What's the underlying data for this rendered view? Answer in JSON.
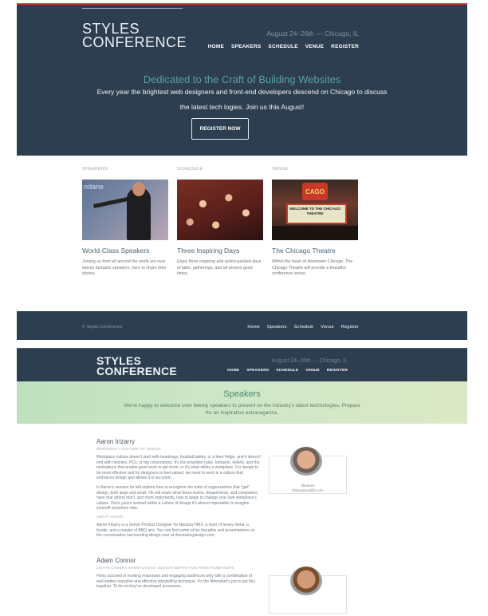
{
  "hero": {
    "logo": [
      "STYLES",
      "CONFERENCE"
    ],
    "date": "August 24–26th — Chicago, IL",
    "nav": [
      "HOME",
      "SPEAKERS",
      "SCHEDULE",
      "VENUE",
      "REGISTER"
    ],
    "headline": "Dedicated to the Craft of Building Websites",
    "lead": "Every year the brightest web designers and front-end developers descend on Chicago to discuss the latest tech logies. Join us this August!",
    "cta": "REGISTER NOW"
  },
  "features": [
    {
      "section": "SPEAKERS",
      "title": "World-Class Speakers",
      "desc": "Joining us from all around the world are over twenty fantastic speakers, here to share their stories."
    },
    {
      "section": "SCHEDULE",
      "title": "Three Inspiring Days",
      "desc": "Enjoy three inspiring and action-packed days of talks, gatherings, and all-around good times."
    },
    {
      "section": "VENUE",
      "title": "The Chicago Theatre",
      "desc": "Within the heart of downtown Chicago, The Chicago Theatre will provide a beautiful conference venue."
    }
  ],
  "images": {
    "speaker_caption": "ndane",
    "theatre_sign": "CAGO",
    "theatre_marquee": "WELCOME TO THE CHICAGO THEATRE"
  },
  "footer": {
    "copy": "© Styles Conference",
    "nav": [
      "Home",
      "Speakers",
      "Schedule",
      "Venue",
      "Register"
    ]
  },
  "header2": {
    "logo": [
      "STYLES",
      "CONFERENCE"
    ],
    "date": "August 24–26th — Chicago, IL",
    "nav": [
      "HOME",
      "SPEAKERS",
      "SCHEDULE",
      "VENUE",
      "REGISTER"
    ]
  },
  "banner": {
    "title": "Speakers",
    "text": "We’re happy to welcome over twenty speakers to present on the industry’s latest technologies. Prepare for an inspiration extravaganza."
  },
  "speakers": [
    {
      "name": "Aaron Irizarry",
      "role": "DESIGNING A CULTURE OF DESIGN",
      "bio1": "Workplace culture doesn't start with beanbags, foosball tables, or a beer fridge, and it doesn't end with neckties, PCs, or big corporations. It's the unwritten rules, behavior, beliefs, and the motivations that enable good work to get done, or it's what stifles a workplace. For design to be most effective and for designers to feel valued, we need to work in a culture that embraces design and allows it to succeed.",
      "bio2": "In Aaron's session he will explore how to recognize the traits of organizations that *get* design, both large and small. He will share what those teams, departments, and companies have that others don't, and more importantly, how to begin to change your own workplace's culture. Once you're worked within a culture of design it's almost impossible to imagine yourself anywhere else.",
      "about_label": "ABOUT AARON",
      "about": "Aaron Irizarry is a Senior Product Designer for Nasdaq OMX, a lover of heavy metal, a foodie, and a master of BBQ arts. You can find some of his thoughts and presentations on the conversation surrounding design over at discussingdesign.com.",
      "handle": "@aaroni",
      "site": "thisisaaronslife.com"
    },
    {
      "name": "Adam Connor",
      "role": "LIGHTS CAMERA INTERACTIONS: DESIGN INSPIRATION FROM FILMMAKERS",
      "bio1": "Films succeed in evoking responses and engaging audiences only with a combination of well-written narrative and effective storytelling technique. It's the filmmaker's job to put this together. To do so they've developed processes,"
    }
  ]
}
